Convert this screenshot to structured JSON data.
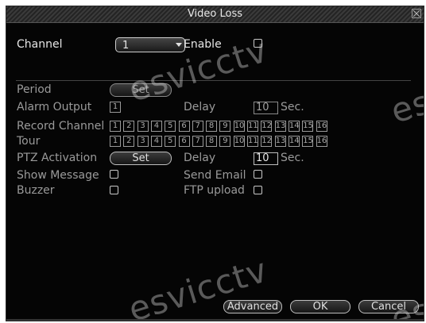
{
  "window": {
    "title": "Video Loss"
  },
  "channel": {
    "label": "Channel",
    "value": "1"
  },
  "enable": {
    "label": "Enable",
    "checked": false
  },
  "period": {
    "label": "Period",
    "button": "Set"
  },
  "alarm_output": {
    "label": "Alarm Output",
    "value": "1"
  },
  "delay1": {
    "label": "Delay",
    "value": "10",
    "unit": "Sec."
  },
  "record_channel": {
    "label": "Record Channel",
    "channels": [
      "1",
      "2",
      "3",
      "4",
      "5",
      "6",
      "7",
      "8",
      "9",
      "10",
      "11",
      "12",
      "13",
      "14",
      "15",
      "16"
    ]
  },
  "tour": {
    "label": "Tour",
    "channels": [
      "1",
      "2",
      "3",
      "4",
      "5",
      "6",
      "7",
      "8",
      "9",
      "10",
      "11",
      "12",
      "13",
      "14",
      "15",
      "16"
    ]
  },
  "ptz": {
    "label": "PTZ Activation",
    "button": "Set"
  },
  "delay2": {
    "label": "Delay",
    "value": "10",
    "unit": "Sec."
  },
  "show_message": {
    "label": "Show Message"
  },
  "send_email": {
    "label": "Send Email"
  },
  "buzzer": {
    "label": "Buzzer"
  },
  "ftp_upload": {
    "label": "FTP upload"
  },
  "buttons": {
    "advanced": "Advanced",
    "ok": "OK",
    "cancel": "Cancel"
  },
  "watermark": "esvicctv",
  "icons": {
    "close": "close-icon",
    "dropdown": "chevron-down-icon"
  },
  "colors": {
    "background": "#050505",
    "text": "#e6e6e6",
    "dim_text": "#9a9a9a"
  }
}
